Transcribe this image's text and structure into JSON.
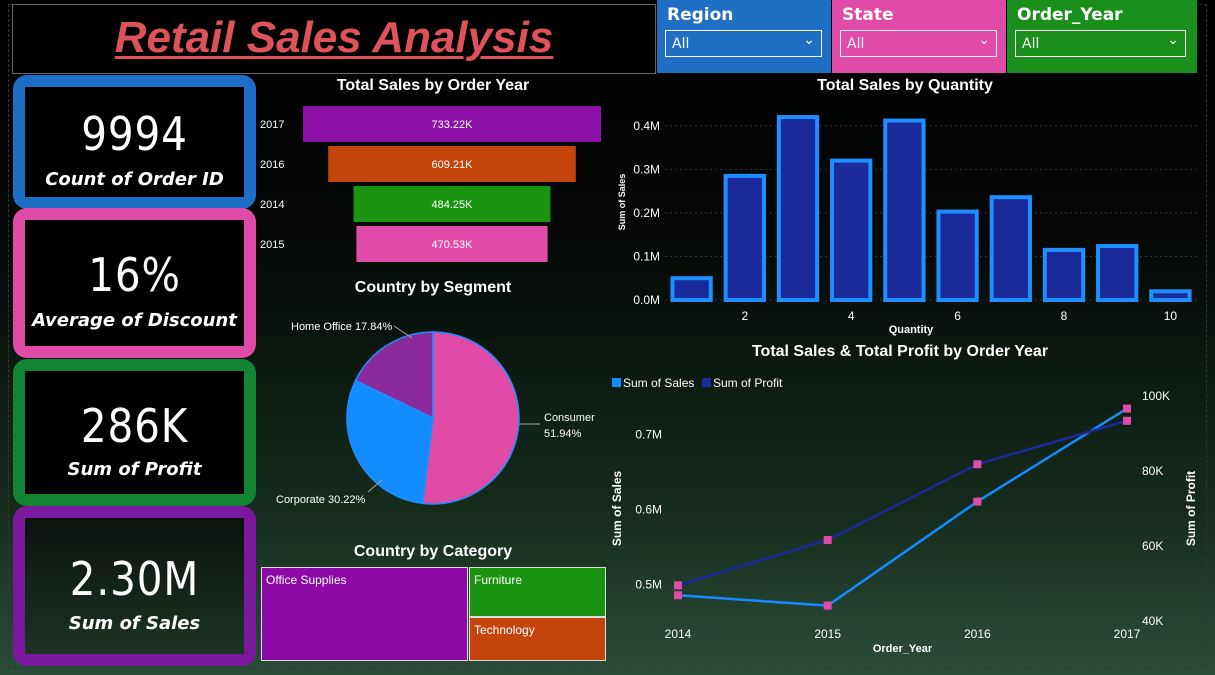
{
  "title": "Retail Sales Analysis",
  "slicers": [
    {
      "label": "Region",
      "value": "All",
      "color": "#1f6fc5"
    },
    {
      "label": "State",
      "value": "All",
      "color": "#e04ba8"
    },
    {
      "label": "Order_Year",
      "value": "All",
      "color": "#1b8f1b"
    }
  ],
  "kpis": [
    {
      "value": "9994",
      "label": "Count of Order ID",
      "color": "#1c6ec7"
    },
    {
      "value": "16%",
      "label": "Average of Discount",
      "color": "#e04ba8"
    },
    {
      "value": "286K",
      "label": "Sum of Profit",
      "color": "#138434"
    },
    {
      "value": "2.30M",
      "label": "Sum of Sales",
      "color": "#7a199e"
    }
  ],
  "chart_titles": {
    "funnel": "Total Sales by Order Year",
    "pie": "Country by Segment",
    "treemap": "Country by Category",
    "bar": "Total Sales by Quantity",
    "combo": "Total Sales & Total Profit by Order Year"
  },
  "chart_data": [
    {
      "type": "bar",
      "title": "Total Sales by Order Year",
      "categories": [
        "2017",
        "2016",
        "2014",
        "2015"
      ],
      "values": [
        733.22,
        609.21,
        484.25,
        470.53
      ],
      "labels": [
        "733.22K",
        "609.21K",
        "484.25K",
        "470.53K"
      ],
      "colors": [
        "#8b10a8",
        "#c4450c",
        "#1a9410",
        "#e04ba8"
      ]
    },
    {
      "type": "pie",
      "title": "Country by Segment",
      "slices": [
        {
          "name": "Consumer",
          "value": 51.94,
          "label_name": "Consumer",
          "label_pct": "51.94%",
          "color": "#e04ba8"
        },
        {
          "name": "Corporate",
          "value": 30.22,
          "label": "Corporate 30.22%",
          "color": "#128cff"
        },
        {
          "name": "Home Office",
          "value": 17.84,
          "label": "Home Office 17.84%",
          "color": "#8a2a9c"
        }
      ]
    },
    {
      "type": "table",
      "title": "Country by Category",
      "items": [
        {
          "name": "Office Supplies",
          "color": "#8b0aa6"
        },
        {
          "name": "Furniture",
          "color": "#1a9410"
        },
        {
          "name": "Technology",
          "color": "#c4450c"
        }
      ]
    },
    {
      "type": "bar",
      "title": "Total Sales by Quantity",
      "xlabel": "Quantity",
      "ylabel": "Sum of Sales",
      "x": [
        1,
        2,
        3,
        4,
        5,
        6,
        7,
        8,
        9,
        10
      ],
      "values": [
        0.05,
        0.285,
        0.42,
        0.32,
        0.412,
        0.203,
        0.236,
        0.115,
        0.124,
        0.02
      ],
      "ylim": [
        0,
        0.45
      ],
      "yticks": [
        0,
        0.1,
        0.2,
        0.3,
        0.4
      ],
      "ytick_labels": [
        "0.0M",
        "0.1M",
        "0.2M",
        "0.3M",
        "0.4M"
      ],
      "xticks": [
        "2",
        "4",
        "6",
        "8",
        "10"
      ],
      "color": "#1a2a9a",
      "edge_color": "#1f8fff"
    },
    {
      "type": "line",
      "title": "Total Sales & Total Profit by Order Year",
      "x": [
        "2014",
        "2015",
        "2016",
        "2017"
      ],
      "xlabel": "Order_Year",
      "ylabel": "Sum of Sales",
      "y2label": "Sum of Profit",
      "ylim": [
        0.45,
        0.75
      ],
      "yticks": [
        "0.5M",
        "0.6M",
        "0.7M"
      ],
      "y2ticks": [
        "40K",
        "60K",
        "80K",
        "100K"
      ],
      "y2lim": [
        40,
        100
      ],
      "series": [
        {
          "name": "Sum of Sales",
          "values": [
            0.4843,
            0.4705,
            0.6092,
            0.7332
          ],
          "axis": "left",
          "color": "#128cff"
        },
        {
          "name": "Sum of Profit",
          "values": [
            49.5,
            61.6,
            81.8,
            93.4
          ],
          "axis": "right",
          "color": "#1a2a9a"
        }
      ],
      "legend": "top-left"
    }
  ]
}
